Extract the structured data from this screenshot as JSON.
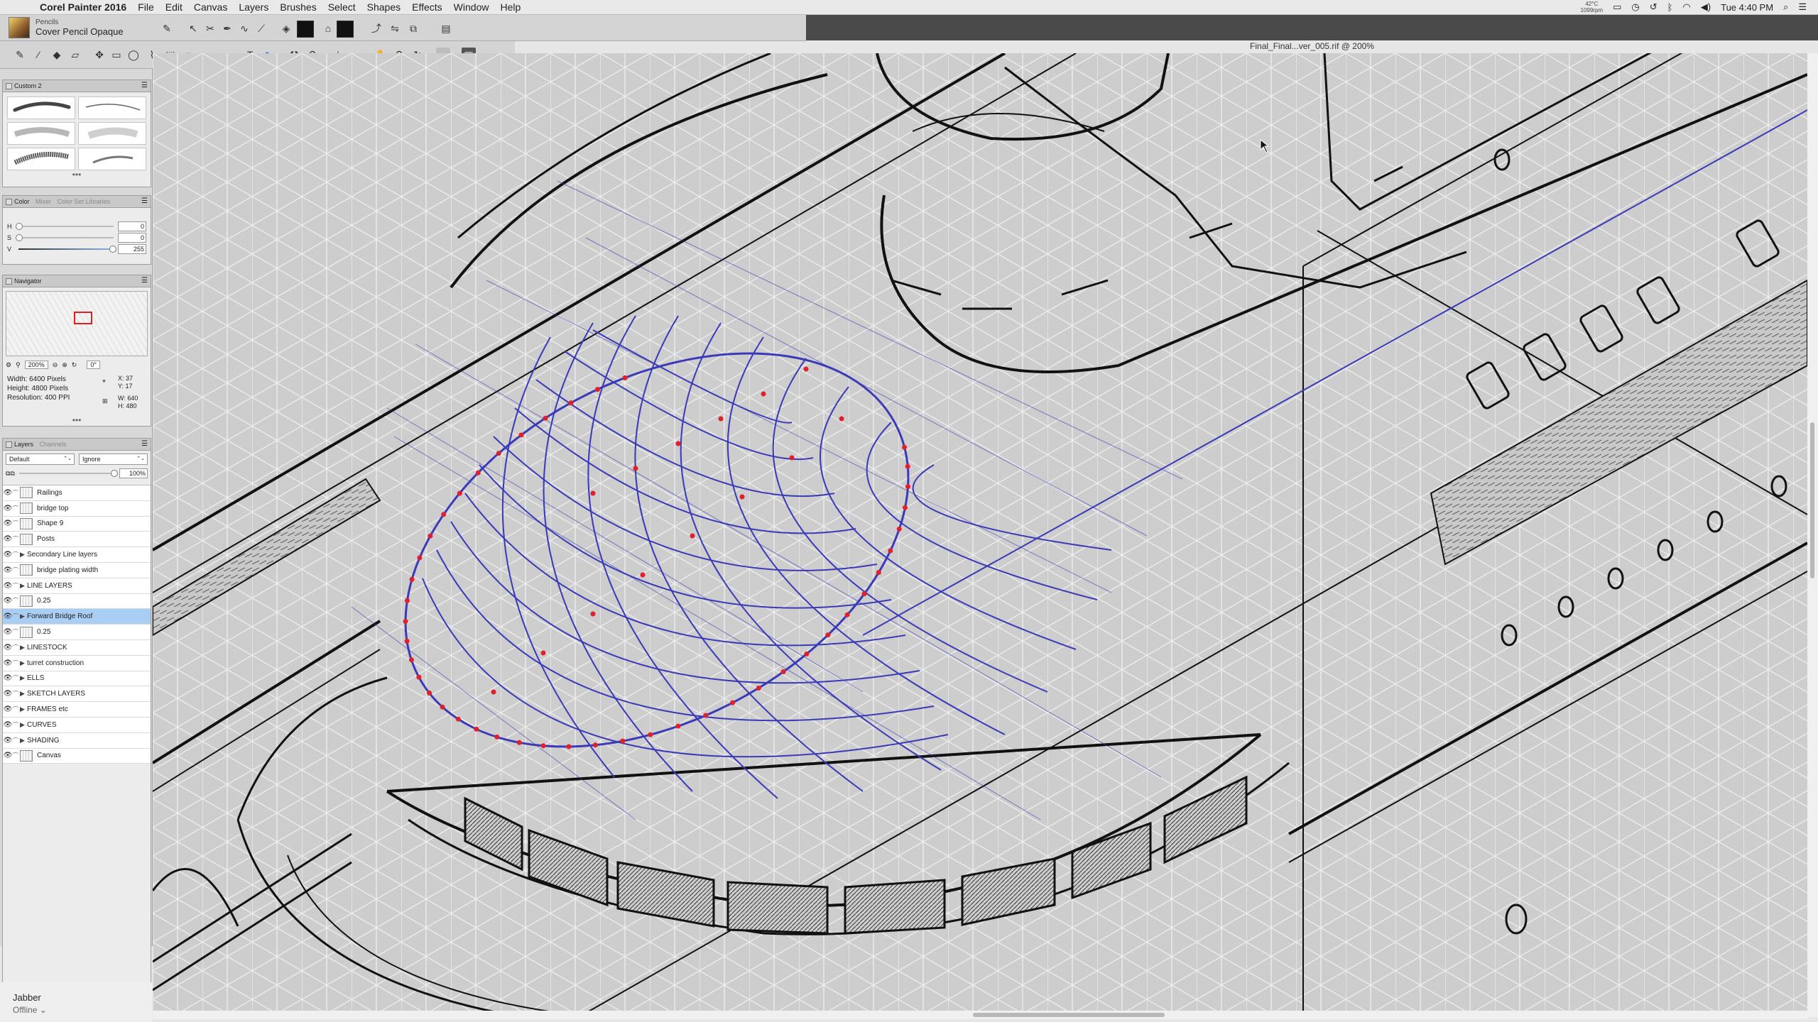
{
  "menubar": {
    "app_name": "Corel Painter 2016",
    "menus": [
      "File",
      "Edit",
      "Canvas",
      "Layers",
      "Brushes",
      "Select",
      "Shapes",
      "Effects",
      "Window",
      "Help"
    ],
    "temp_top": "42°C",
    "temp_bottom": "1099rpm",
    "clock": "Tue 4:40 PM"
  },
  "brush": {
    "category": "Pencils",
    "variant": "Cover Pencil Opaque"
  },
  "document": {
    "title": "Final_Final...ver_005.rif @ 200%"
  },
  "brush_library": {
    "tab": "Custom 2"
  },
  "color_panel": {
    "tabs": [
      "Color",
      "Mixer",
      "Color Set Libraries"
    ],
    "rows": [
      {
        "label": "H",
        "value": "0"
      },
      {
        "label": "S",
        "value": "0"
      },
      {
        "label": "V",
        "value": "255"
      }
    ]
  },
  "navigator": {
    "title": "Navigator",
    "zoom": "200%",
    "rotation": "0°",
    "width_label": "Width:",
    "width_value": "6400 Pixels",
    "height_label": "Height:",
    "height_value": "4800 Pixels",
    "res_label": "Resolution:",
    "res_value": "400 PPI",
    "x": "X:  37",
    "y": "Y:  17",
    "w": "W: 640",
    "h": "H: 480"
  },
  "layers_panel": {
    "tabs": [
      "Layers",
      "Channels"
    ],
    "composite_method": "Default",
    "preserve": "Ignore",
    "opacity": "100%",
    "layers": [
      {
        "name": "Railings",
        "type": "layer",
        "selected": false
      },
      {
        "name": "bridge top",
        "type": "layer",
        "selected": false
      },
      {
        "name": "Shape 9",
        "type": "layer",
        "selected": false
      },
      {
        "name": "Posts",
        "type": "layer",
        "selected": false
      },
      {
        "name": "Secondary Line layers",
        "type": "group",
        "selected": false
      },
      {
        "name": "bridge plating width",
        "type": "layer",
        "selected": false
      },
      {
        "name": "LINE LAYERS",
        "type": "group",
        "selected": false
      },
      {
        "name": "0.25",
        "type": "layer",
        "selected": false
      },
      {
        "name": "Forward Bridge Roof",
        "type": "group",
        "selected": true
      },
      {
        "name": "0.25",
        "type": "layer",
        "selected": false
      },
      {
        "name": "LINESTOCK",
        "type": "group",
        "selected": false
      },
      {
        "name": "turret construction",
        "type": "group",
        "selected": false
      },
      {
        "name": "ELLS",
        "type": "group",
        "selected": false
      },
      {
        "name": "SKETCH LAYERS",
        "type": "group",
        "selected": false
      },
      {
        "name": "FRAMES etc",
        "type": "group",
        "selected": false
      },
      {
        "name": "CURVES",
        "type": "group",
        "selected": false
      },
      {
        "name": "SHADING",
        "type": "group",
        "selected": false
      },
      {
        "name": "Canvas",
        "type": "canvas",
        "selected": false
      }
    ]
  },
  "status": {
    "jabber": "Jabber",
    "presence": "Offline ⌄"
  },
  "colors": {
    "selection_highlight": "#a9cdf3",
    "grid_blue": "#3a3ab8",
    "control_point_red": "#e0202a"
  }
}
